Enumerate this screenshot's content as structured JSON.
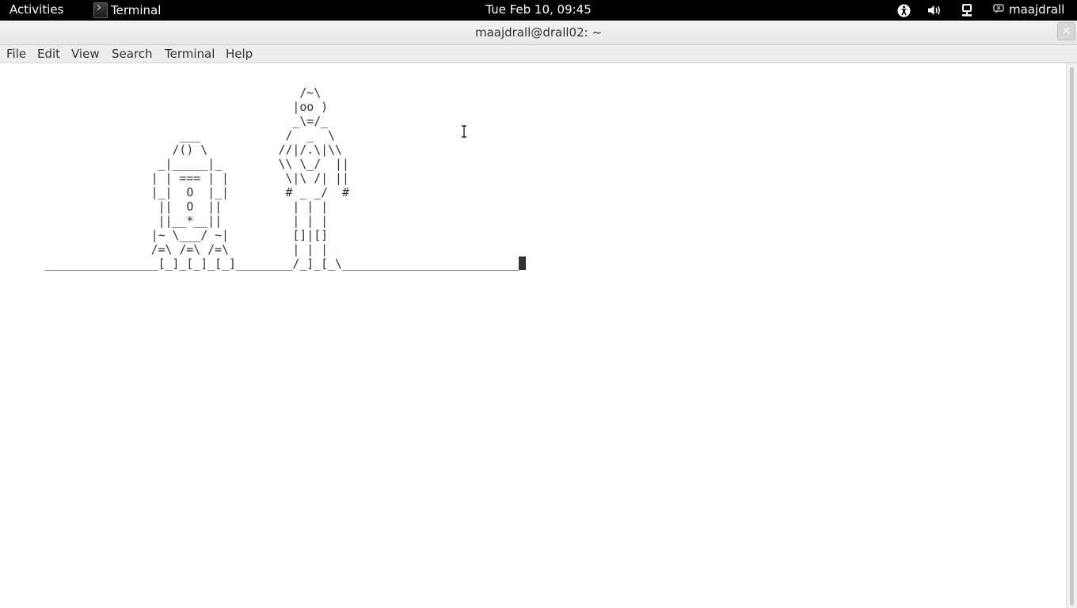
{
  "topbar": {
    "activities_label": "Activities",
    "app_name": "Terminal",
    "clock": "Tue Feb 10, 09:45",
    "username": "maajdrall",
    "icons": [
      "accessibility-icon",
      "volume-icon",
      "network-icon",
      "user-status-icon"
    ]
  },
  "window": {
    "title": "maajdrall@drall02: ~",
    "close_glyph": "×"
  },
  "menubar": {
    "file": "File",
    "edit": "Edit",
    "view": "View",
    "search": "Search",
    "terminal": "Terminal",
    "help": "Help"
  },
  "terminal": {
    "lines": [
      "                                          /~\\",
      "                                         |oo )",
      "                                         _\\=/_",
      "                         ___            /  _  \\",
      "                        /() \\          //|/.\\|\\\\",
      "                      _|_____|_        \\\\ \\_/  ||",
      "                     | | === | |        \\|\\ /| ||",
      "                     |_|  O  |_|        # _ _/  #",
      "                      ||  O  ||          | | |",
      "                      ||__*__||          | | |",
      "                     |~ \\___/ ~|         []|[]",
      "                     /=\\ /=\\ /=\\         | | |",
      "      ________________[_]_[_]_[_]________/_]_[_\\_________________________"
    ],
    "colors": {
      "foreground": "#2e3436",
      "background": "#ffffff"
    }
  }
}
